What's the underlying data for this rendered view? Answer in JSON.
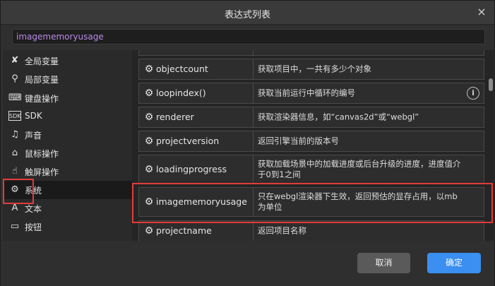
{
  "dialog": {
    "title": "表达式列表",
    "close_label": "×"
  },
  "search": {
    "value": "imagememoryusage"
  },
  "sidebar": {
    "items": [
      {
        "icon": "x-variable-icon",
        "glyph": "✘",
        "label": "全局变量"
      },
      {
        "icon": "location-pin-icon",
        "glyph": "⚲",
        "label": "局部变量"
      },
      {
        "icon": "keyboard-icon",
        "glyph": "⌨",
        "label": "键盘操作"
      },
      {
        "icon": "sdk-icon",
        "glyph": "SDK",
        "label": "SDK"
      },
      {
        "icon": "sound-wave-icon",
        "glyph": "♫",
        "label": "声音"
      },
      {
        "icon": "mouse-icon",
        "glyph": "⌂",
        "label": "鼠标操作"
      },
      {
        "icon": "touch-icon",
        "glyph": "☝",
        "label": "触屏操作"
      },
      {
        "icon": "gear-icon",
        "glyph": "⚙",
        "label": "系统"
      },
      {
        "icon": "text-icon",
        "glyph": "A",
        "label": "文本"
      },
      {
        "icon": "button-icon",
        "glyph": "▭",
        "label": "按钮"
      }
    ],
    "active_index": 7
  },
  "expressions": [
    {
      "name": "",
      "desc": "",
      "info": false
    },
    {
      "name": "objectcount",
      "desc": "获取项目中，一共有多少个对象",
      "info": false
    },
    {
      "name": "loopindex()",
      "desc": "获取当前运行中循环的编号",
      "info": true
    },
    {
      "name": "renderer",
      "desc": "获取渲染器信息，如“canvas2d”或“webgl”",
      "info": false
    },
    {
      "name": "projectversion",
      "desc": "返回引擎当前的版本号",
      "info": false
    },
    {
      "name": "loadingprogress",
      "desc": "获取加载场景中的加载进度或后台升级的进度，进度值介于0到1之间",
      "info": false
    },
    {
      "name": "imagememoryusage",
      "desc": "只在webgl渲染器下生效，返回预估的显存占用，以mb为单位",
      "info": false
    },
    {
      "name": "projectname",
      "desc": "返回项目名称",
      "info": false
    }
  ],
  "info_glyph": "i",
  "gear_glyph": "⚙",
  "buttons": {
    "cancel": "取消",
    "ok": "确定"
  },
  "colors": {
    "accent": "#3a8ff0",
    "highlight_box": "#e23b3b",
    "search_text": "#b98be8"
  }
}
